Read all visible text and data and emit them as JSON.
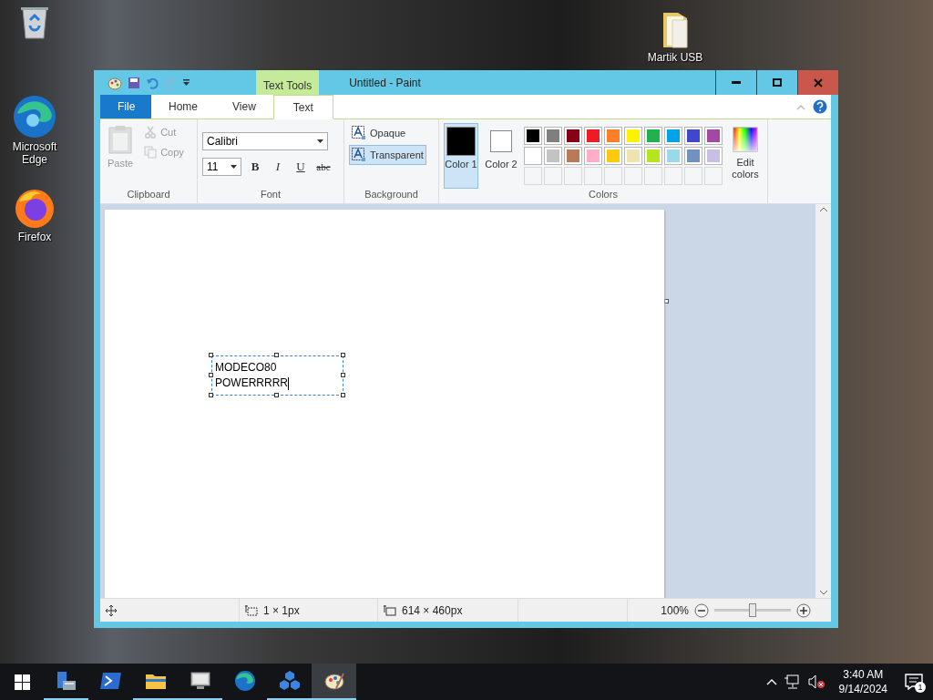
{
  "desktop_icons": [
    {
      "kind": "recycle-bin"
    },
    {
      "kind": "edge",
      "label": "Microsoft Edge"
    },
    {
      "kind": "firefox",
      "label": "Firefox"
    },
    {
      "kind": "folder",
      "label": "Martik USB"
    }
  ],
  "window": {
    "title": "Untitled - Paint",
    "context_tab": "Text Tools"
  },
  "tabs": [
    {
      "label": "File",
      "kind": "file",
      "selected": false
    },
    {
      "label": "Home",
      "kind": "tab",
      "selected": false
    },
    {
      "label": "View",
      "kind": "tab",
      "selected": false
    },
    {
      "label": "Text",
      "kind": "tab",
      "selected": true
    }
  ],
  "clipboard": {
    "title": "Clipboard",
    "paste": {
      "label": "Paste",
      "disabled": true
    },
    "cut": {
      "label": "Cut",
      "disabled": true
    },
    "copy": {
      "label": "Copy",
      "disabled": true
    }
  },
  "font": {
    "title": "Font",
    "family": "Calibri",
    "size": "11",
    "styles": [
      {
        "label": "B",
        "kind": "bold",
        "selected": false
      },
      {
        "label": "I",
        "kind": "italic",
        "selected": false
      },
      {
        "label": "U",
        "kind": "underline",
        "selected": false
      },
      {
        "label": "abc",
        "kind": "strike",
        "selected": false
      }
    ]
  },
  "background": {
    "title": "Background",
    "options": [
      {
        "label": "Opaque",
        "selected": false
      },
      {
        "label": "Transparent",
        "selected": true
      }
    ]
  },
  "colors": {
    "title": "Colors",
    "slots": [
      {
        "label": "Color 1",
        "color": "#000000",
        "selected": true
      },
      {
        "label": "Color 2",
        "color": "#ffffff",
        "selected": false
      }
    ],
    "palette": [
      {
        "kind": "swatch",
        "color": "#000000"
      },
      {
        "kind": "swatch",
        "color": "#7f7f7f"
      },
      {
        "kind": "swatch",
        "color": "#880015"
      },
      {
        "kind": "swatch",
        "color": "#ed1c24"
      },
      {
        "kind": "swatch",
        "color": "#ff7f27"
      },
      {
        "kind": "swatch",
        "color": "#fff200"
      },
      {
        "kind": "swatch",
        "color": "#22b14c"
      },
      {
        "kind": "swatch",
        "color": "#00a2e8"
      },
      {
        "kind": "swatch",
        "color": "#3f48cc"
      },
      {
        "kind": "swatch",
        "color": "#a349a4"
      },
      {
        "kind": "swatch",
        "color": "#ffffff"
      },
      {
        "kind": "swatch",
        "color": "#c3c3c3"
      },
      {
        "kind": "swatch",
        "color": "#b97a57"
      },
      {
        "kind": "swatch",
        "color": "#ffaec9"
      },
      {
        "kind": "swatch",
        "color": "#ffc90e"
      },
      {
        "kind": "swatch",
        "color": "#efe4b0"
      },
      {
        "kind": "swatch",
        "color": "#b5e61d"
      },
      {
        "kind": "swatch",
        "color": "#99d9ea"
      },
      {
        "kind": "swatch",
        "color": "#7092be"
      },
      {
        "kind": "swatch",
        "color": "#c8bfe7"
      },
      {
        "kind": "empty"
      },
      {
        "kind": "empty"
      },
      {
        "kind": "empty"
      },
      {
        "kind": "empty"
      },
      {
        "kind": "empty"
      },
      {
        "kind": "empty"
      },
      {
        "kind": "empty"
      },
      {
        "kind": "empty"
      },
      {
        "kind": "empty"
      },
      {
        "kind": "empty"
      }
    ],
    "edit": "Edit colors"
  },
  "canvas": {
    "text_lines": [
      "MODECO80",
      "POWERRRRR"
    ]
  },
  "status_bar": {
    "selection_size": "1 × 1px",
    "image_size": "614 × 460px",
    "zoom": "100%",
    "zoom_slider": {
      "level": 0.5
    }
  },
  "taskbar": {
    "apps": [
      {
        "kind": "server-manager",
        "running": true,
        "selected": false
      },
      {
        "kind": "powershell",
        "running": false,
        "selected": false
      },
      {
        "kind": "file-explorer",
        "running": true,
        "selected": false
      },
      {
        "kind": "monitor",
        "running": true,
        "selected": false
      },
      {
        "kind": "edge",
        "running": false,
        "selected": false
      },
      {
        "kind": "cubes",
        "running": true,
        "selected": false
      },
      {
        "kind": "paint",
        "running": true,
        "selected": true
      }
    ],
    "time": "3:40 AM",
    "date": "9/14/2024",
    "notifications": "1"
  }
}
